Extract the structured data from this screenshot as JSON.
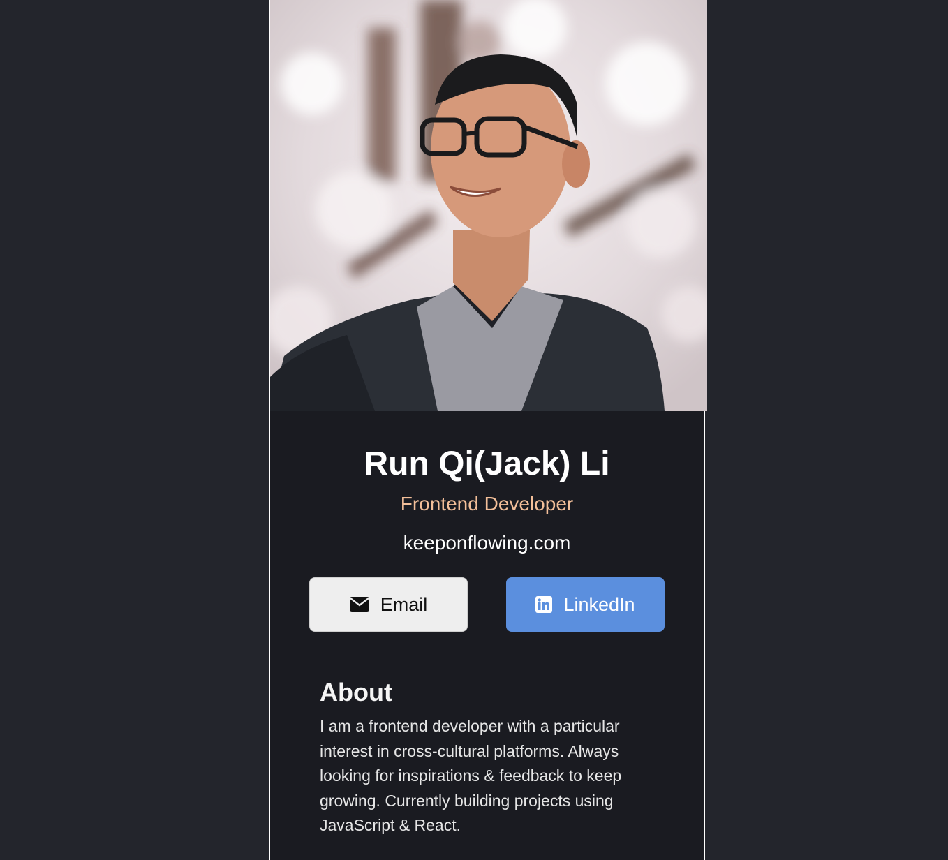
{
  "profile": {
    "name": "Run Qi(Jack) Li",
    "role": "Frontend Developer",
    "website": "keeponflowing.com"
  },
  "buttons": {
    "email_label": "Email",
    "email_icon": "envelope-icon",
    "linkedin_label": "LinkedIn",
    "linkedin_icon": "linkedin-icon"
  },
  "about": {
    "heading": "About",
    "body": "I am a frontend developer with a particular interest in cross-cultural platforms. Always looking for inspirations & feedback to keep growing. Currently building projects using JavaScript & React."
  },
  "colors": {
    "background": "#23252c",
    "card": "#1a1b21",
    "role_accent": "#f3bf99",
    "linkedin_button": "#5b8fde",
    "email_button": "#eeeeee"
  }
}
